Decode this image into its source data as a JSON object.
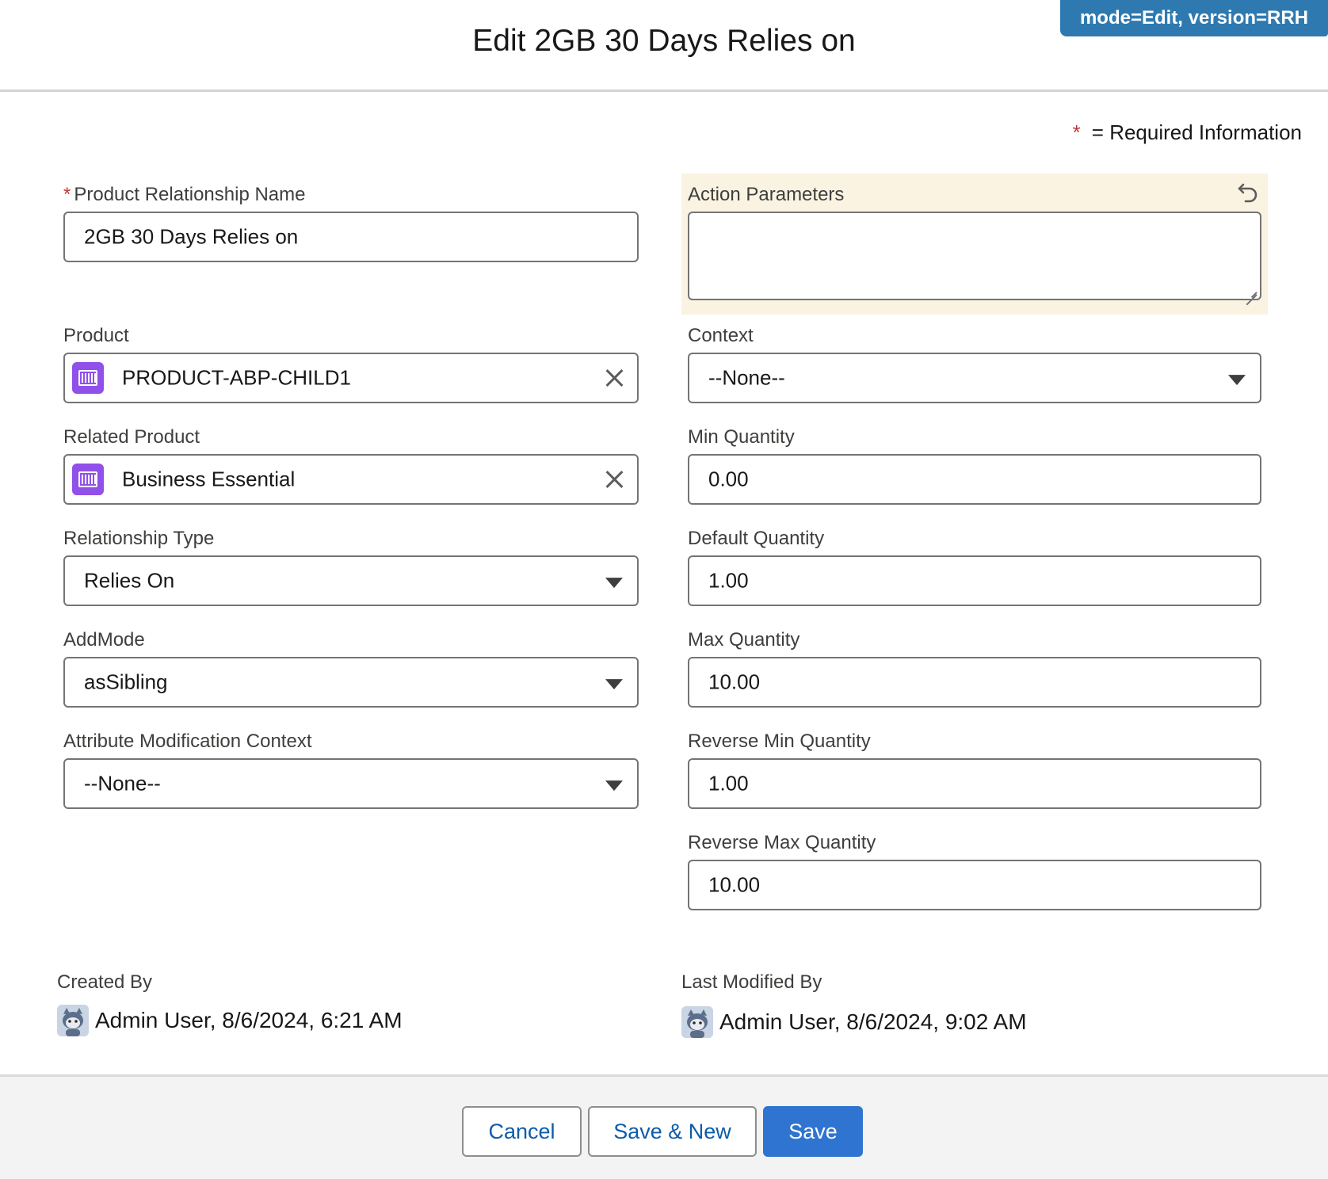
{
  "modal": {
    "title": "Edit 2GB 30 Days Relies on",
    "debug_badge": "mode=Edit, version=RRH",
    "required_legend_star": "*",
    "required_legend_text": "= Required Information"
  },
  "left_fields": {
    "name": {
      "label": "Product Relationship Name",
      "required_mark": "*",
      "value": "2GB 30 Days Relies on"
    },
    "product": {
      "label": "Product",
      "value": "PRODUCT-ABP-CHILD1",
      "icon": "product-icon"
    },
    "related_product": {
      "label": "Related Product",
      "value": "Business Essential",
      "icon": "product-icon"
    },
    "relationship_type": {
      "label": "Relationship Type",
      "value": "Relies On"
    },
    "add_mode": {
      "label": "AddMode",
      "value": "asSibling"
    },
    "attr_mod_context": {
      "label": "Attribute Modification Context",
      "value": "--None--"
    }
  },
  "right_fields": {
    "action_parameters": {
      "label": "Action Parameters",
      "value": ""
    },
    "context": {
      "label": "Context",
      "value": "--None--"
    },
    "min_quantity": {
      "label": "Min Quantity",
      "value": "0.00"
    },
    "default_quantity": {
      "label": "Default Quantity",
      "value": "1.00"
    },
    "max_quantity": {
      "label": "Max Quantity",
      "value": "10.00"
    },
    "reverse_min_quantity": {
      "label": "Reverse Min Quantity",
      "value": "1.00"
    },
    "reverse_max_quantity": {
      "label": "Reverse Max Quantity",
      "value": "10.00"
    }
  },
  "system_info": {
    "created_by": {
      "label": "Created By",
      "value": "Admin User, 8/6/2024, 6:21 AM"
    },
    "last_modified_by": {
      "label": "Last Modified By",
      "value": "Admin User, 8/6/2024, 9:02 AM"
    }
  },
  "footer": {
    "cancel_label": "Cancel",
    "save_new_label": "Save & New",
    "save_label": "Save"
  },
  "colors": {
    "brand": "#2e74d0",
    "link": "#0b5cab",
    "required": "#c23934",
    "product_icon_bg": "#9050e9",
    "highlight_bg": "#faf3e2",
    "debug_badge_bg": "#2e7ab0"
  }
}
